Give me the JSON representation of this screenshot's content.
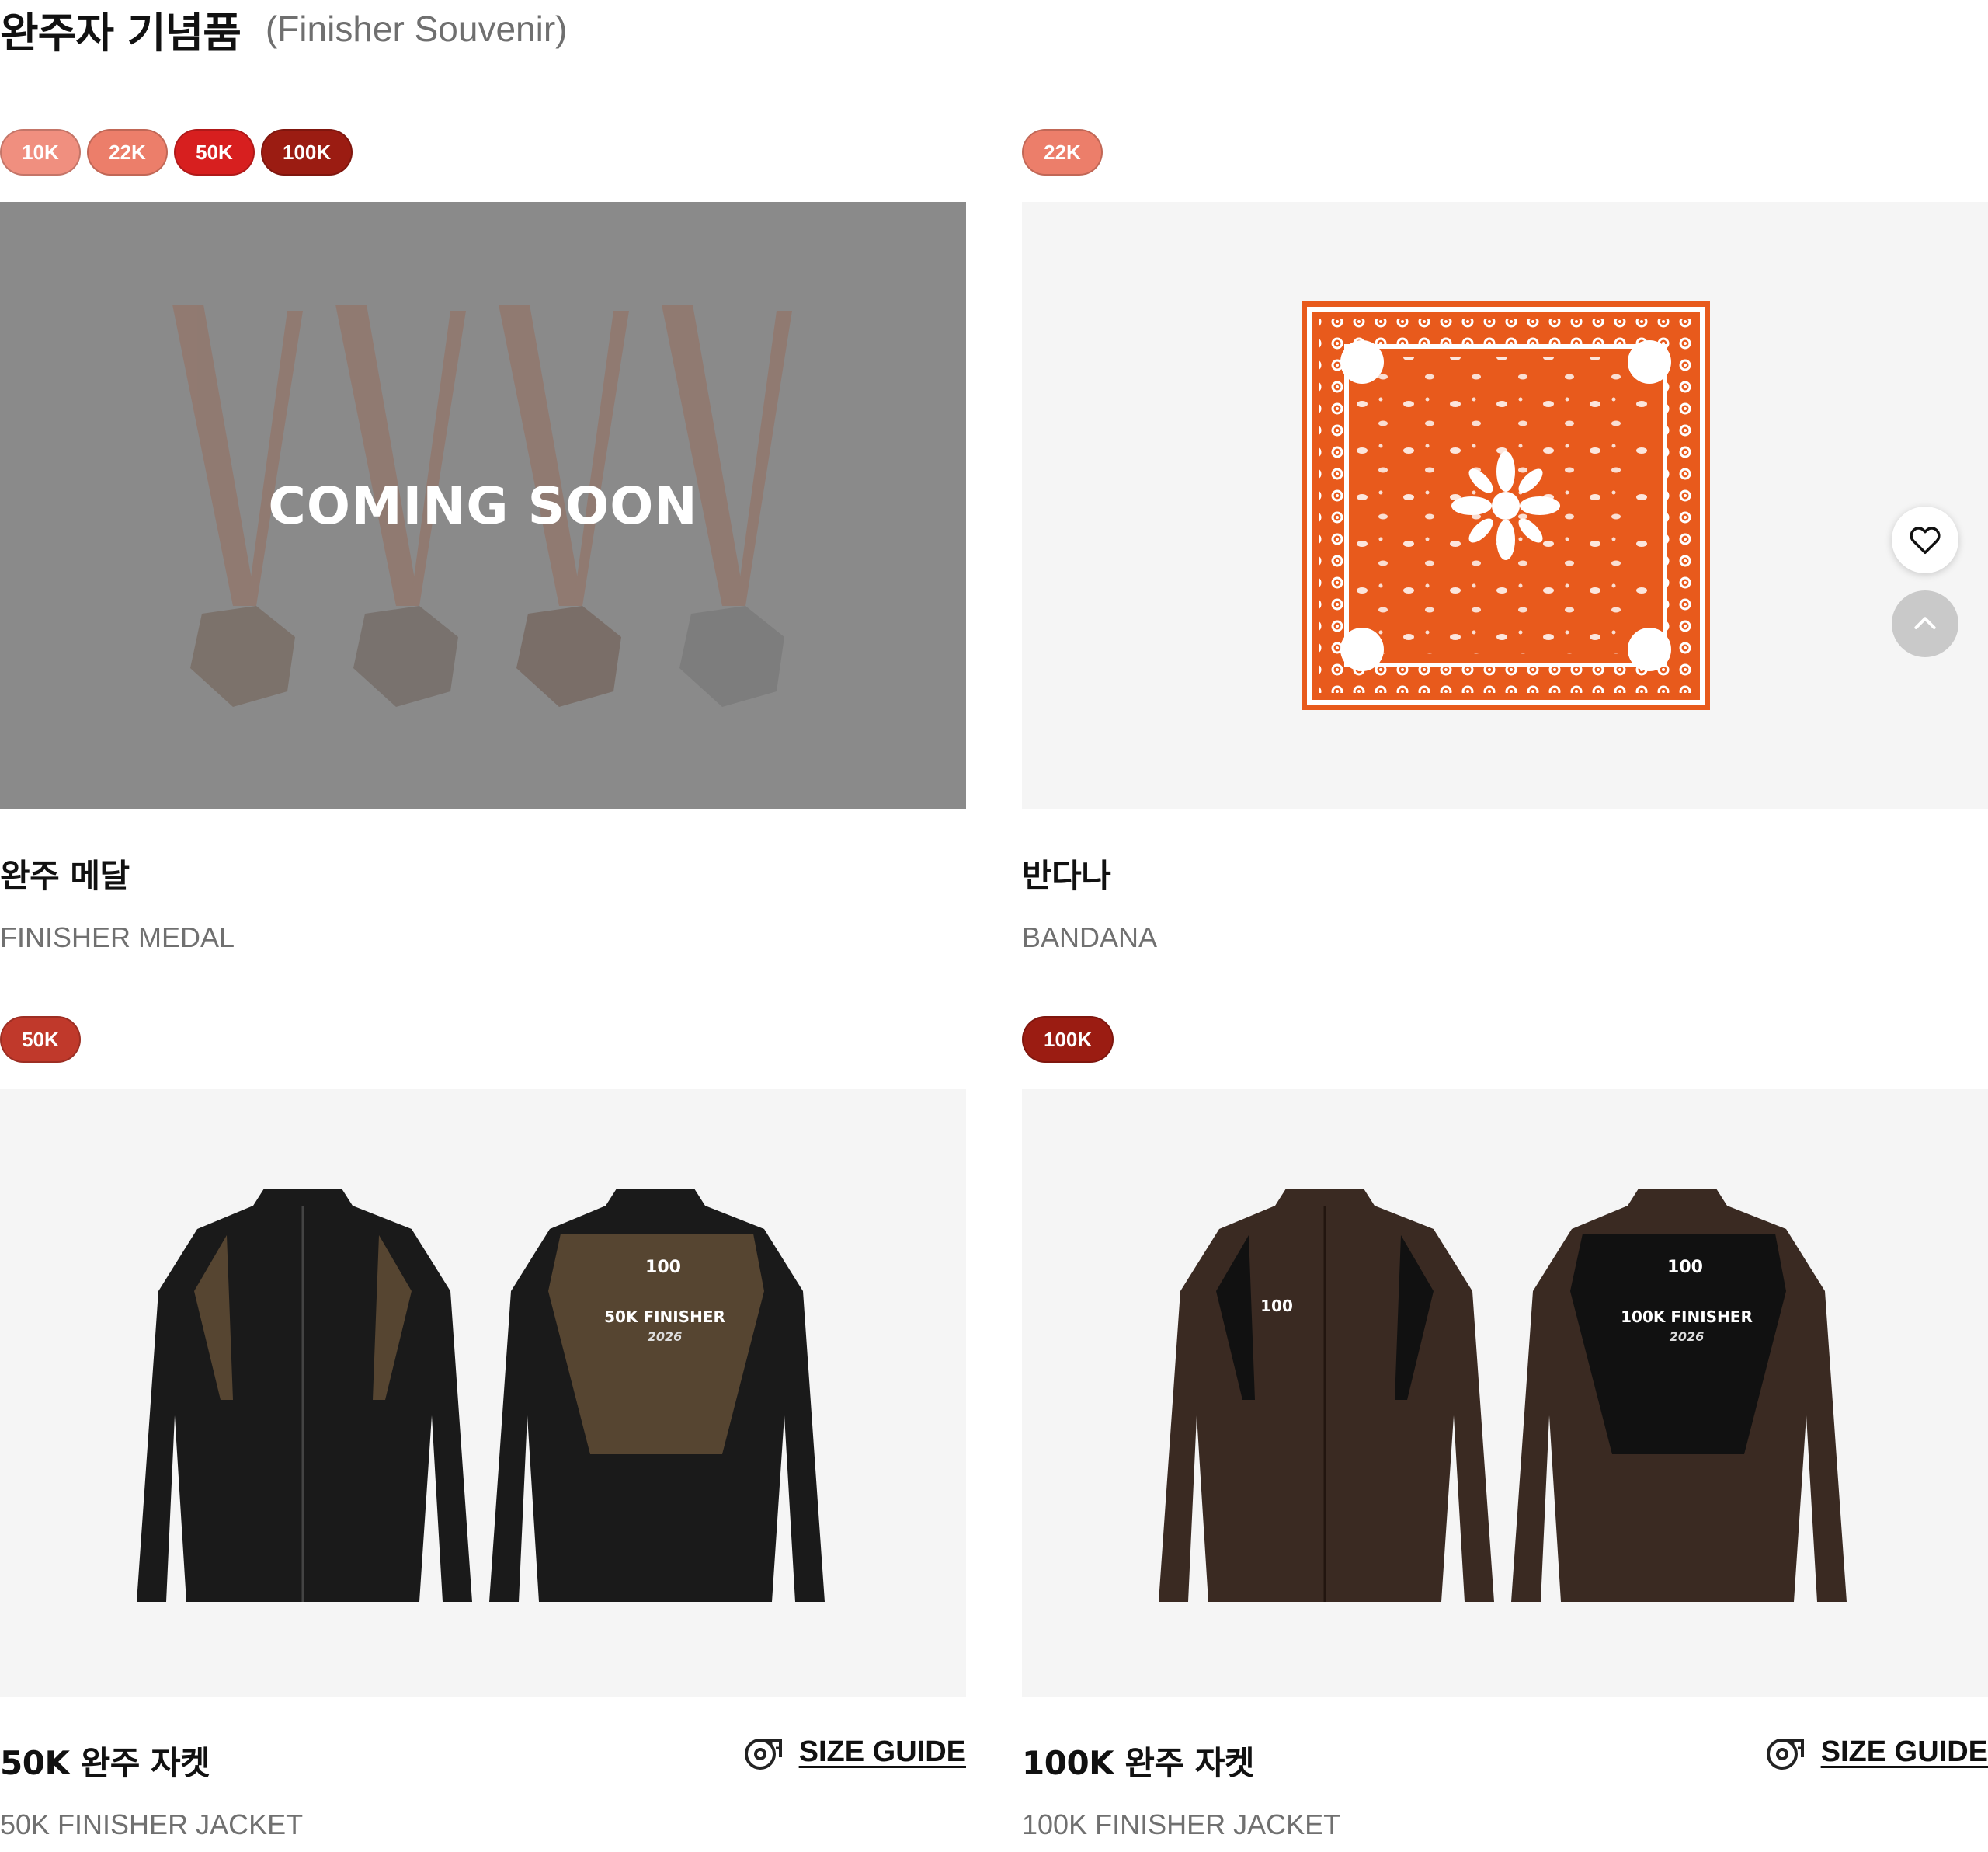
{
  "header": {
    "title": "완주자 기념품",
    "subtitle": "(Finisher Souvenir)"
  },
  "products": [
    {
      "tags": [
        {
          "label": "10K",
          "color": "#f08f7f"
        },
        {
          "label": "22K",
          "color": "#ec7e6a"
        },
        {
          "label": "50K",
          "color": "#d71f1f"
        },
        {
          "label": "100K",
          "color": "#9b1c12"
        }
      ],
      "overlay": "COMING SOON",
      "name_ko": "완주 메달",
      "name_en": "FINISHER MEDAL"
    },
    {
      "tags": [
        {
          "label": "22K",
          "color": "#ec7e6a"
        }
      ],
      "name_ko": "반다나",
      "name_en": "BANDANA"
    },
    {
      "tags": [
        {
          "label": "50K",
          "color": "#c0392b"
        }
      ],
      "back_print": [
        "50K FINISHER",
        "2026"
      ],
      "name_ko": "50K 완주 자켓",
      "name_en": "50K FINISHER JACKET",
      "size_guide": "SIZE GUIDE"
    },
    {
      "tags": [
        {
          "label": "100K",
          "color": "#9b1c12"
        }
      ],
      "back_print": [
        "100K FINISHER",
        "2026"
      ],
      "name_ko": "100K 완주 자켓",
      "name_en": "100K FINISHER JACKET",
      "size_guide": "SIZE GUIDE"
    }
  ],
  "logo_text": "100",
  "colors": {
    "bandana": "#e85a1c",
    "jacket_black": "#1a1a1a",
    "jacket_olive": "#564531",
    "jacket_brown": "#3a2a22"
  },
  "icons": {
    "wishlist": "heart-icon",
    "scroll_top": "chevron-up-icon",
    "size_guide": "tape-measure-icon"
  }
}
